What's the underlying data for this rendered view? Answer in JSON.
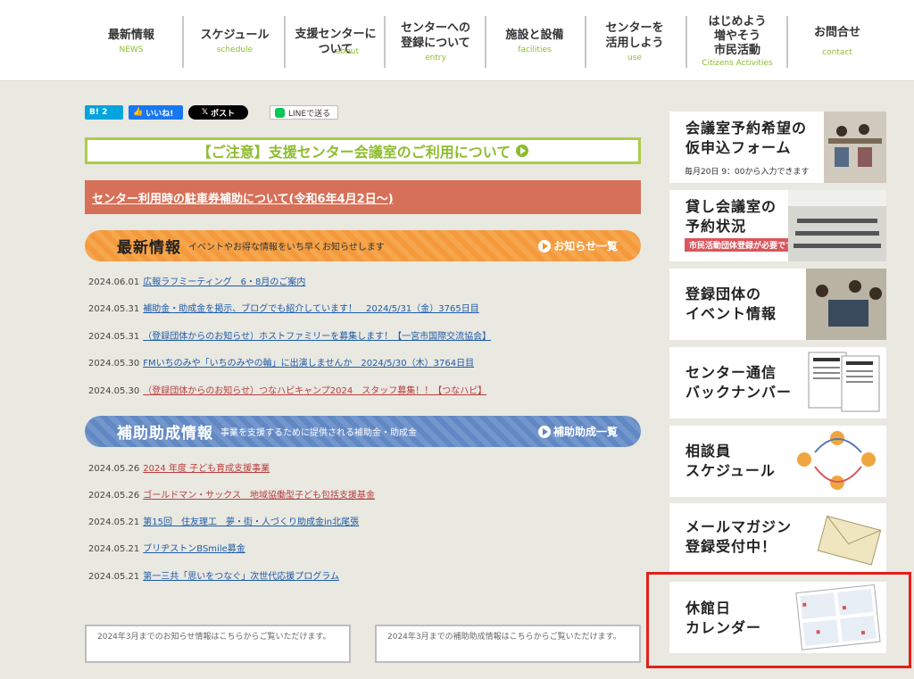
{
  "nav": [
    {
      "jp": "最新情報",
      "en": "NEWS"
    },
    {
      "jp": "スケジュール",
      "en": "schedule"
    },
    {
      "jp": "支援センターに\nついて",
      "en": "about"
    },
    {
      "jp": "センターへの\n登録について",
      "en": "entry"
    },
    {
      "jp": "施設と設備",
      "en": "facilities"
    },
    {
      "jp": "センターを\n活用しよう",
      "en": "use"
    },
    {
      "jp": "はじめよう\n増やそう\n市民活動",
      "en": "Citizens Activities"
    },
    {
      "jp": "お問合せ",
      "en": "contact"
    }
  ],
  "social": {
    "hatena": "B! 2",
    "fb": "いいね!",
    "x": "ポスト",
    "line": "LINEで送る"
  },
  "notice_green": "【ご注意】支援センター会議室のご利用について",
  "notice_red": "センター利用時の駐車券補助について(令和6年4月2日〜)",
  "news": {
    "title": "最新情報",
    "subtitle": "イベントやお得な情報をいち早くお知らせします",
    "more": "お知らせ一覧",
    "items": [
      {
        "date": "2024.06.01",
        "title": "広報ラフミーティング　6・8月のご案内",
        "color": "blue"
      },
      {
        "date": "2024.05.31",
        "title": "補助金・助成金を掲示、ブログでも紹介しています！　2024/5/31（金）3765日目",
        "color": "blue"
      },
      {
        "date": "2024.05.31",
        "title": "（登録団体からのお知らせ）ホストファミリーを募集します！【一宮市国際交流協会】",
        "color": "blue"
      },
      {
        "date": "2024.05.30",
        "title": "FMいちのみや「いちのみやの輪」に出演しませんか　2024/5/30（木）3764日目",
        "color": "blue"
      },
      {
        "date": "2024.05.30",
        "title": "（登録団体からのお知らせ）つなハピキャンプ2024　スタッフ募集！！【つなハピ】",
        "color": "red"
      }
    ]
  },
  "grants": {
    "title": "補助助成情報",
    "subtitle": "事業を支援するために提供される補助金・助成金",
    "more": "補助助成一覧",
    "items": [
      {
        "date": "2024.05.26",
        "title": "2024 年度 子ども育成支援事業",
        "color": "red"
      },
      {
        "date": "2024.05.26",
        "title": "ゴールドマン・サックス　地域協働型子ども包括支援基金",
        "color": "red"
      },
      {
        "date": "2024.05.21",
        "title": "第15回　住友理工　夢・街・人づくり助成金in北尾張",
        "color": "blue"
      },
      {
        "date": "2024.05.21",
        "title": "ブリヂストンBSmile募金",
        "color": "blue"
      },
      {
        "date": "2024.05.21",
        "title": "第一三共「思いをつなぐ」次世代応援プログラム",
        "color": "blue"
      }
    ]
  },
  "archive": {
    "news": "2024年3月までのお知らせ情報はこちらからご覧いただけます。",
    "grants": "2024年3月までの補助助成情報はこちらからご覧いただけます。"
  },
  "sidebar": [
    {
      "text": "会議室予約希望の\n仮申込フォーム",
      "sub": "毎月20日 9：00から入力できます"
    },
    {
      "text": "貸し会議室の\n予約状況",
      "tag": "市民活動団体登録が必要です"
    },
    {
      "text": "登録団体の\nイベント情報"
    },
    {
      "text": "センター通信\nバックナンバー"
    },
    {
      "text": "相談員\nスケジュール"
    },
    {
      "text": "メールマガジン\n登録受付中！"
    },
    {
      "text": "休館日\nカレンダー"
    }
  ],
  "colors": {
    "green": "#8dbd2e",
    "orange": "#f49a3c",
    "blue": "#6288c4",
    "red_banner": "#d67058",
    "highlight": "#e1201c"
  }
}
